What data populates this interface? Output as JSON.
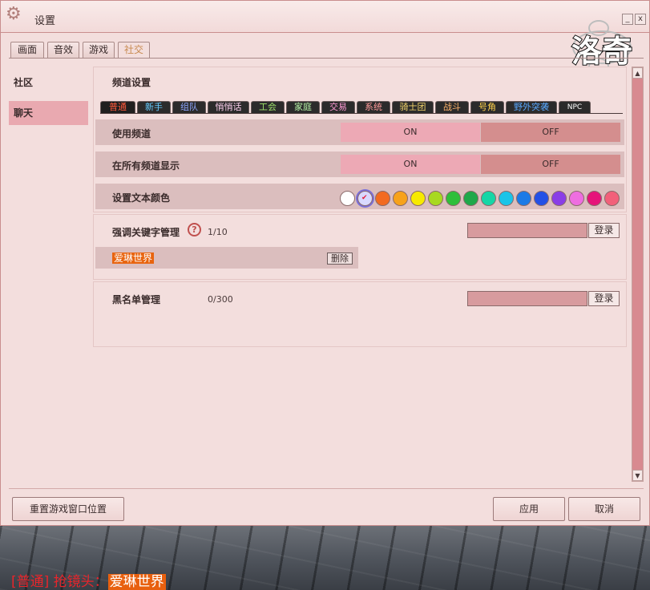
{
  "window": {
    "title": "设置"
  },
  "title_buttons": {
    "minimize": "_",
    "close": "x"
  },
  "logo": {
    "text": "洛奇"
  },
  "top_tabs": [
    "画面",
    "音效",
    "游戏",
    "社交"
  ],
  "nav": {
    "items": [
      "社区",
      "聊天"
    ]
  },
  "channel_settings": {
    "title": "频道设置",
    "tabs": [
      {
        "label": "普通",
        "color": "#ff5a3c"
      },
      {
        "label": "新手",
        "color": "#66ccff"
      },
      {
        "label": "组队",
        "color": "#8fa6ff"
      },
      {
        "label": "悄悄话",
        "color": "#ffd1f0"
      },
      {
        "label": "工会",
        "color": "#9ee36b"
      },
      {
        "label": "家庭",
        "color": "#b6f2a6"
      },
      {
        "label": "交易",
        "color": "#ff9ad5"
      },
      {
        "label": "系统",
        "color": "#ff9a9a"
      },
      {
        "label": "骑士团",
        "color": "#f2d36b"
      },
      {
        "label": "战斗",
        "color": "#ffb36b"
      },
      {
        "label": "号角",
        "color": "#ffd24d"
      },
      {
        "label": "野外突袭",
        "color": "#5aa8ff"
      },
      {
        "label": "NPC",
        "color": "#ffffff"
      }
    ]
  },
  "rows": {
    "use_channel": {
      "label": "使用频道",
      "on": "ON",
      "off": "OFF"
    },
    "show_all": {
      "label": "在所有频道显示",
      "on": "ON",
      "off": "OFF"
    },
    "text_color": {
      "label": "设置文本颜色",
      "selected_index": 1,
      "colors": [
        "#ffffff",
        "#d9d9ff",
        "#f26a21",
        "#f7a21b",
        "#f7ea00",
        "#a8d920",
        "#2fbf3a",
        "#1fa84a",
        "#16d6a6",
        "#19c4e8",
        "#1c7ae6",
        "#2350e6",
        "#8a3ee6",
        "#ee6ee0",
        "#e6147a",
        "#f2607a"
      ]
    }
  },
  "keywords": {
    "label": "强调关键字管理",
    "help_icon": "?",
    "count": "1/10",
    "input_value": "",
    "register_button": "登录",
    "items": [
      {
        "name": "爱琳世界",
        "delete_label": "删除"
      }
    ]
  },
  "blacklist": {
    "label": "黑名单管理",
    "count": "0/300",
    "input_value": "",
    "register_button": "登录"
  },
  "footer": {
    "reset_button": "重置游戏窗口位置",
    "apply_button": "应用",
    "cancel_button": "取消"
  },
  "chat_message": {
    "channel": "[普通]",
    "sender": "抢镜头：",
    "name": "爱琳世界"
  }
}
